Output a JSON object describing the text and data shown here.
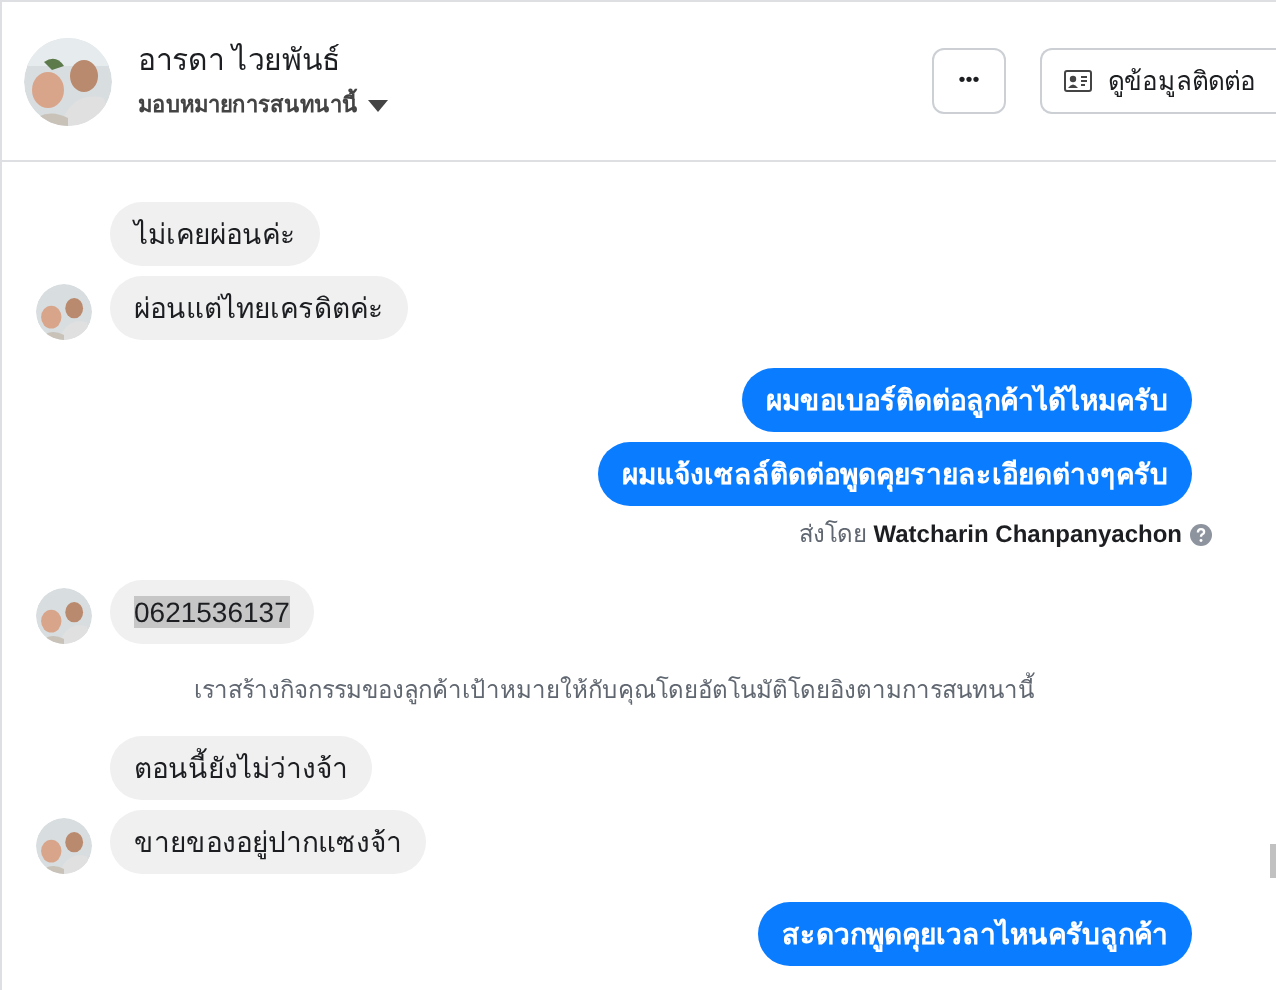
{
  "header": {
    "name": "อารดา ไวยพันธ์",
    "assign": "มอบหมายการสนทนานี้",
    "more_button": "•••",
    "contact_button": "ดูข้อมูลติดต่อ"
  },
  "messages": [
    {
      "kind": "incoming",
      "text": "ไม่เคยผ่อนค่ะ",
      "avatar": false
    },
    {
      "kind": "incoming",
      "text": "ผ่อนแต่ไทยเครดิตค่ะ",
      "avatar": true
    },
    {
      "kind": "outgoing",
      "text": "ผมขอเบอร์ติดต่อลูกค้าได้ไหมครับ"
    },
    {
      "kind": "outgoing",
      "text": "ผมแจ้งเซลล์ติดต่อพูดคุยรายละเอียดต่างๆครับ"
    },
    {
      "kind": "sent_by",
      "prefix": "ส่งโดย",
      "name": "Watcharin Chanpanyachon"
    },
    {
      "kind": "incoming",
      "text": "0621536137",
      "avatar": true,
      "highlighted": true
    },
    {
      "kind": "system",
      "text": "เราสร้างกิจกรรมของลูกค้าเป้าหมายให้กับคุณโดยอัตโนมัติโดยอิงตามการสนทนานี้"
    },
    {
      "kind": "incoming",
      "text": "ตอนนี้ยังไม่ว่างจ้า",
      "avatar": false
    },
    {
      "kind": "incoming",
      "text": "ขายของอยู่ปากแซงจ้า",
      "avatar": true
    },
    {
      "kind": "outgoing",
      "text": "สะดวกพูดคุยเวลาไหนครับลูกค้า"
    }
  ]
}
